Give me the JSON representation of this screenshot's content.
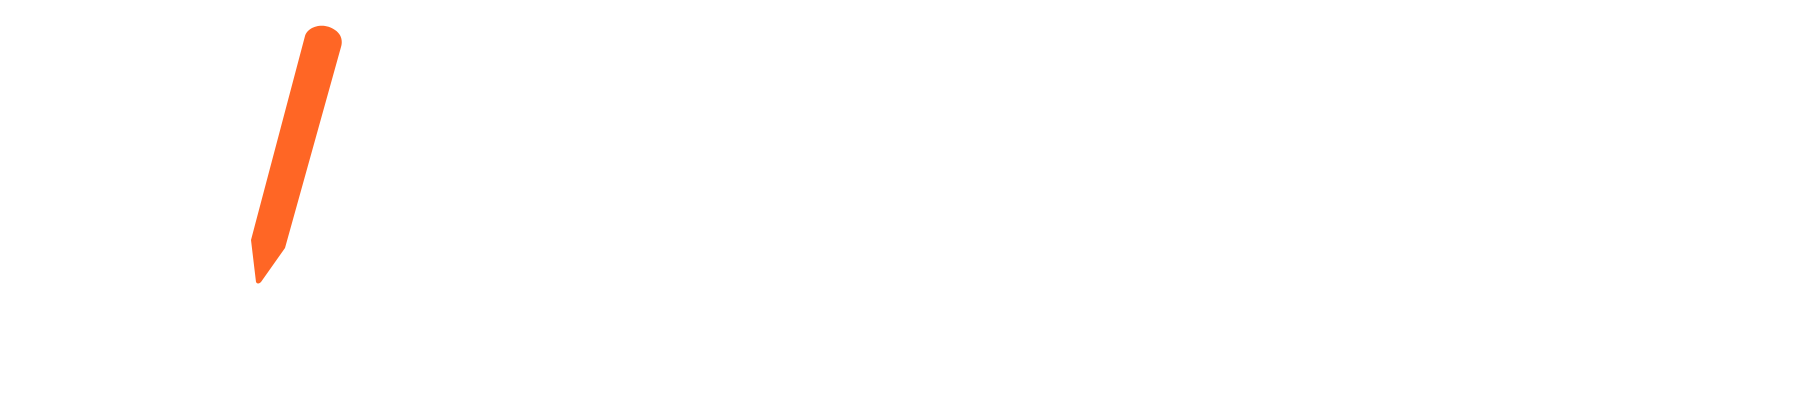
{
  "canvas": {
    "background_color": "#ffffff"
  },
  "pencil": {
    "icon": "pencil-icon",
    "color": "#ff6625"
  }
}
